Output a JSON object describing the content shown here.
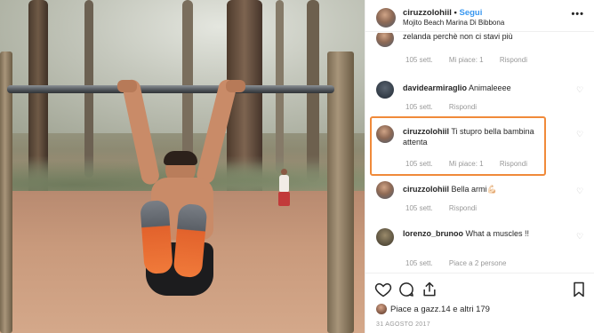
{
  "post": {
    "username": "ciruzzolohiil",
    "separator": "•",
    "follow_label": "Segui",
    "location": "Mojito Beach Marina Di Bibbona",
    "more_label": "•••"
  },
  "comments": [
    {
      "text": "zelanda perchè non ci stavi più",
      "meta": [
        "105 sett.",
        "Mi piace: 1",
        "Rispondi"
      ]
    },
    {
      "user": "davidearmiraglio",
      "text": "Animaleeee",
      "meta": [
        "105 sett.",
        "Rispondi"
      ]
    },
    {
      "user": "ciruzzolohiil",
      "text": "Ti stupro bella bambina attenta",
      "meta": [
        "105 sett.",
        "Mi piace: 1",
        "Rispondi"
      ]
    },
    {
      "user": "ciruzzolohiil",
      "text": "Bella armi",
      "emoji": "💪🏻",
      "meta": [
        "105 sett.",
        "Rispondi"
      ]
    },
    {
      "user": "lorenzo_brunoo",
      "text": "What a muscles !!",
      "meta": [
        "105 sett.",
        "Piace a 2 persone"
      ]
    }
  ],
  "actions": {
    "like_icon": "heart-icon",
    "comment_icon": "comment-icon",
    "share_icon": "share-icon",
    "save_icon": "bookmark-icon"
  },
  "likes": {
    "text": "Piace a gazz.14 e altri 179"
  },
  "date": "31 AGOSTO 2017",
  "colors": {
    "link_blue": "#3897f0",
    "highlight": "#f08a3a"
  }
}
